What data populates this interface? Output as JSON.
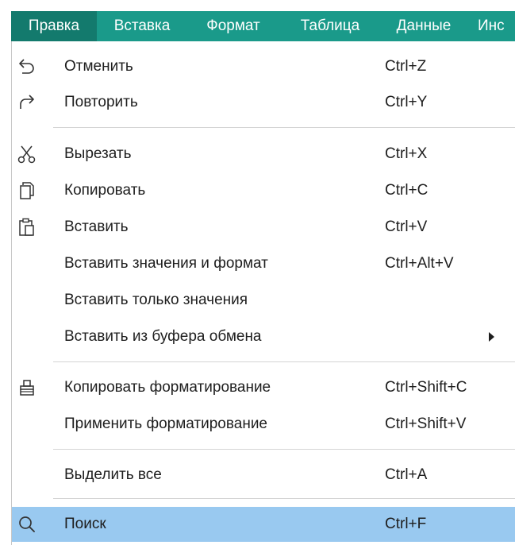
{
  "menubar": {
    "items": [
      {
        "label": "Правка",
        "active": true
      },
      {
        "label": "Вставка"
      },
      {
        "label": "Формат"
      },
      {
        "label": "Таблица"
      },
      {
        "label": "Данные"
      },
      {
        "label": "Инс"
      }
    ],
    "bg_color": "#1a9a8a",
    "active_color": "#137a6d"
  },
  "edit_menu": {
    "items": [
      {
        "label": "Отменить",
        "shortcut": "Ctrl+Z",
        "icon": "undo-icon"
      },
      {
        "label": "Повторить",
        "shortcut": "Ctrl+Y",
        "icon": "redo-icon"
      },
      {
        "label": "Вырезать",
        "shortcut": "Ctrl+X",
        "icon": "scissors-icon"
      },
      {
        "label": "Копировать",
        "shortcut": "Ctrl+C",
        "icon": "copy-icon"
      },
      {
        "label": "Вставить",
        "shortcut": "Ctrl+V",
        "icon": "paste-icon"
      },
      {
        "label": "Вставить значения и формат",
        "shortcut": "Ctrl+Alt+V"
      },
      {
        "label": "Вставить только значения",
        "shortcut": ""
      },
      {
        "label": "Вставить из буфера обмена",
        "shortcut": "",
        "submenu": true
      },
      {
        "label": "Копировать форматирование",
        "shortcut": "Ctrl+Shift+C",
        "icon": "format-painter-icon"
      },
      {
        "label": "Применить форматирование",
        "shortcut": "Ctrl+Shift+V"
      },
      {
        "label": "Выделить все",
        "shortcut": "Ctrl+A"
      },
      {
        "label": "Поиск",
        "shortcut": "Ctrl+F",
        "icon": "search-icon",
        "highlighted": true
      }
    ],
    "highlight_color": "#99c9f0"
  }
}
